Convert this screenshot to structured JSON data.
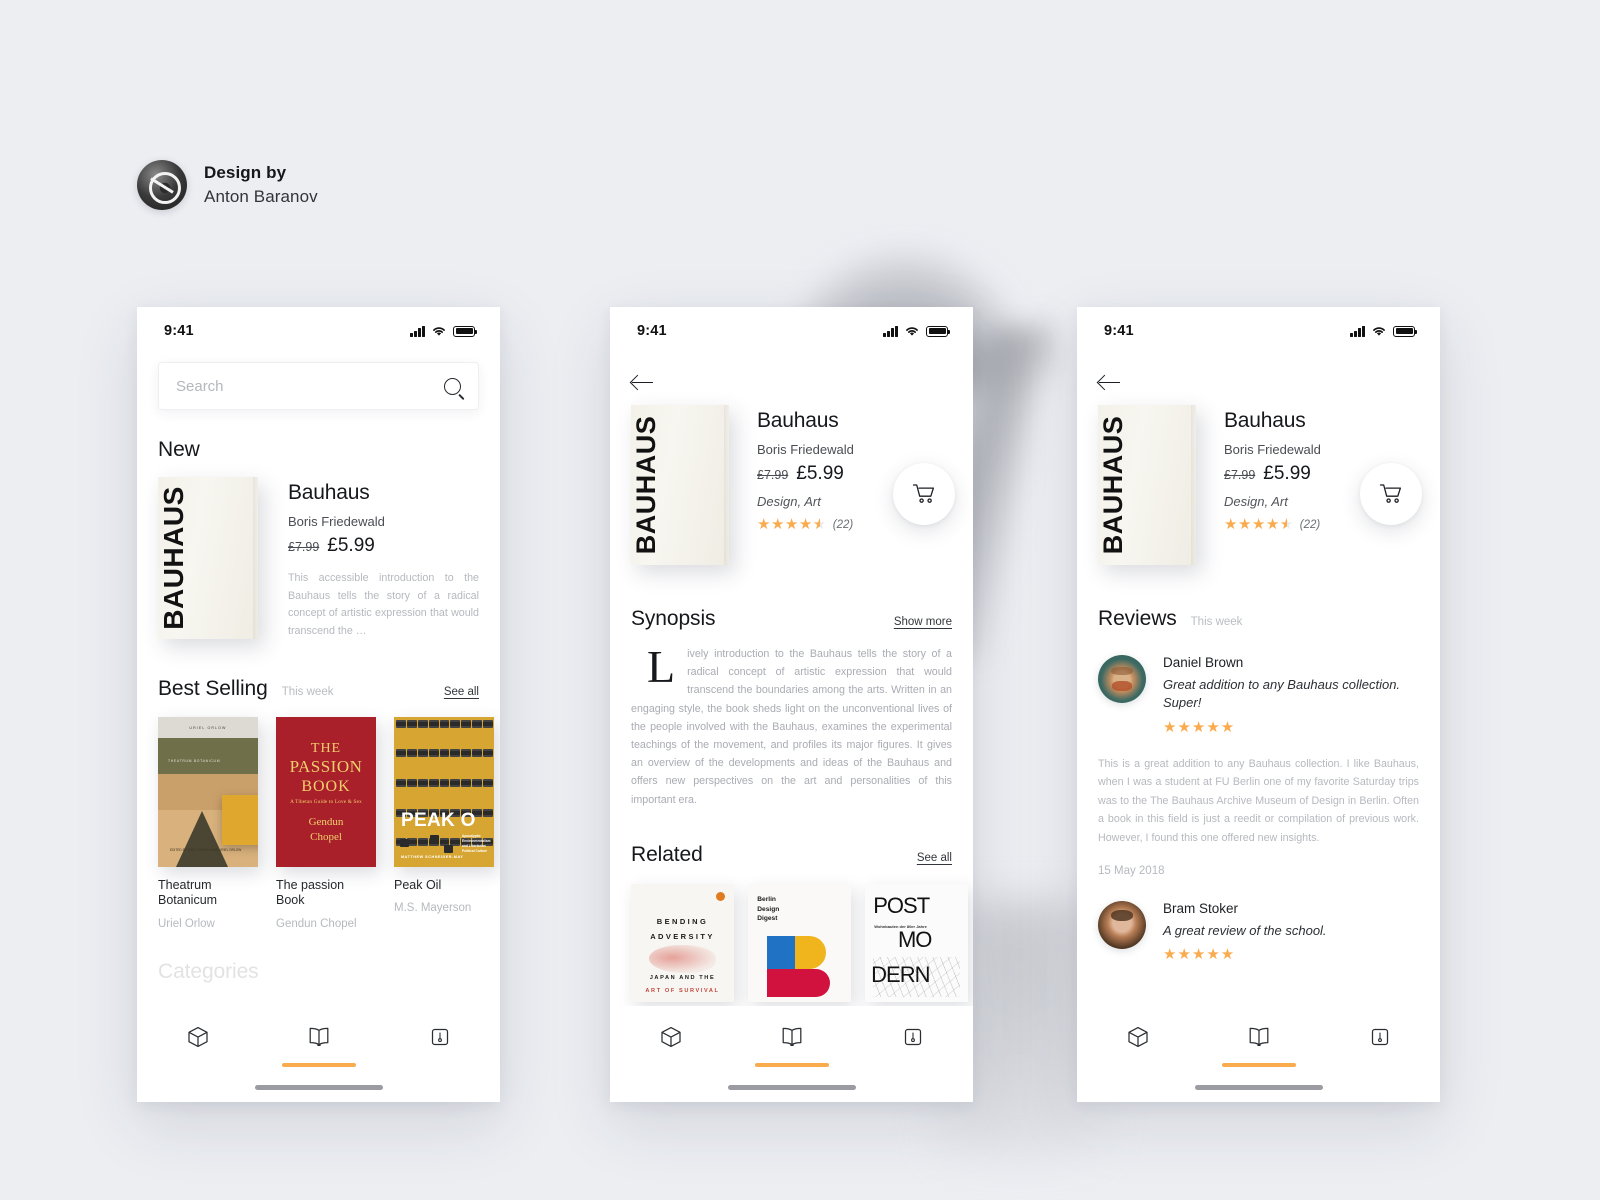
{
  "credit": {
    "line1": "Design by",
    "line2": "Anton Baranov",
    "avatar_icon": "designer-avatar"
  },
  "accent_color": "#f9ab4e",
  "background_color": "#eceef2",
  "statusbar": {
    "time": "9:41",
    "signal_icon": "cellular-signal-icon",
    "wifi_icon": "wifi-icon",
    "battery_icon": "battery-full-icon"
  },
  "tabbar": {
    "tabs": [
      {
        "name": "box-icon",
        "active": false
      },
      {
        "name": "book-icon",
        "active": true
      },
      {
        "name": "bookmark-icon",
        "active": false
      }
    ]
  },
  "home": {
    "search": {
      "placeholder": "Search",
      "value": "",
      "icon": "search-icon"
    },
    "new": {
      "title": "New",
      "book": {
        "cover_text": "BAUHAUS",
        "title": "Bauhaus",
        "author": "Boris Friedewald",
        "price_old": "£7.99",
        "price_new": "£5.99",
        "blurb": "This accessible introduction to the Bauhaus tells the story of a radical concept of artistic expression that would transcend the  …"
      }
    },
    "best_selling": {
      "title": "Best Selling",
      "subtitle": "This week",
      "see_all": "See all",
      "books": [
        {
          "title": "Theatrum Botanicum",
          "author": "Uriel Orlow",
          "cover": "theatrum",
          "cover_author": "URIEL ORLOW",
          "cover_title": "THEATRUM BOTANICUM",
          "cover_footer": "EDITED BY SHELA SHEIKH AND URIEL ORLOW"
        },
        {
          "title": "The passion Book",
          "author": "Gendun Chopel",
          "cover": "passion",
          "cover_l1": "THE",
          "cover_l2": "PASSION",
          "cover_l3": "BOOK",
          "cover_sub": "A Tibetan Guide to Love & Sex",
          "cover_a1": "Gendun",
          "cover_a2": "Chopel"
        },
        {
          "title": "Peak Oil",
          "author": "M.S. Mayerson",
          "cover": "peak",
          "cover_title": "PEAK O",
          "cover_sub": "Apocalyptic Environmentalism and Libertarian Political Culture",
          "cover_author": "MATTHEW SCHNEIDER-MAY"
        }
      ]
    },
    "categories_title": "Categories"
  },
  "detail": {
    "back_icon": "back-arrow-icon",
    "book": {
      "cover_text": "BAUHAUS",
      "title": "Bauhaus",
      "author": "Boris Friedewald",
      "price_old": "£7.99",
      "price_new": "£5.99",
      "genre": "Design, Art",
      "rating": 4.5,
      "rating_count": "(22)"
    },
    "cart_icon": "shopping-cart-icon",
    "synopsis": {
      "title": "Synopsis",
      "show_more": "Show more",
      "dropcap": "L",
      "text": "ively introduction to the Bauhaus tells the story of a radical concept of artistic expression that would transcend the boundaries among the arts. Written in an engaging style, the book sheds light on the unconventional lives of the people involved with the Bauhaus, examines the experimental teachings of the movement, and profiles its major figures. It gives an overview of the developments and ideas of the Bauhaus and offers new perspectives on the art and personalities of this important era."
    },
    "related": {
      "title": "Related",
      "see_all": "See all",
      "books": [
        {
          "cover": "bending",
          "l1": "BENDING",
          "l2": "ADVERSITY",
          "l3": "JAPAN AND THE",
          "l4": "ART OF SURVIVAL"
        },
        {
          "cover": "berlin",
          "l1": "Berlin",
          "l2": "Design",
          "l3": "Digest"
        },
        {
          "cover": "post",
          "l1": "POST",
          "l2": "MO",
          "l3": "DERN",
          "sub": "Wohnbauten der 80er Jahre"
        }
      ]
    }
  },
  "reviews": {
    "back_icon": "back-arrow-icon",
    "book": {
      "cover_text": "BAUHAUS",
      "title": "Bauhaus",
      "author": "Boris Friedewald",
      "price_old": "£7.99",
      "price_new": "£5.99",
      "genre": "Design, Art",
      "rating": 4.5,
      "rating_count": "(22)"
    },
    "cart_icon": "shopping-cart-icon",
    "section": {
      "title": "Reviews",
      "subtitle": "This week"
    },
    "items": [
      {
        "avatar": "van-gogh-avatar",
        "name": "Daniel Brown",
        "quote": "Great addition to any Bauhaus collection. Super!",
        "stars": "★★★★",
        "half": "★",
        "body": "This is a great addition to any Bauhaus collection. I like Bauhaus, when I was a student at FU Berlin one of my favorite Saturday trips was to the The Bauhaus Archive Museum of Design in Berlin. Often a book in this field is just a reedit or compilation of previous work. However, I found this one offered new insights.",
        "date": "15 May 2018"
      },
      {
        "avatar": "rembrandt-avatar",
        "name": "Bram Stoker",
        "quote": "A great review of the school.",
        "stars": "★★★★★",
        "half": "",
        "body": "",
        "date": ""
      }
    ]
  }
}
